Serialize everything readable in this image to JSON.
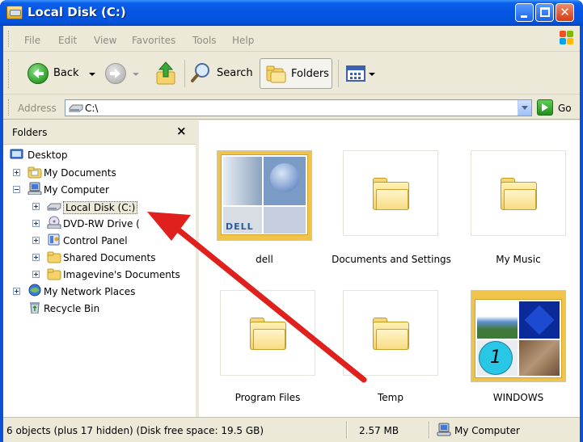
{
  "window": {
    "title": "Local Disk (C:)"
  },
  "menu": {
    "items": [
      "File",
      "Edit",
      "View",
      "Favorites",
      "Tools",
      "Help"
    ]
  },
  "toolbar": {
    "back_label": "Back",
    "search_label": "Search",
    "folders_label": "Folders"
  },
  "address": {
    "label": "Address",
    "value": "C:\\",
    "go_label": "Go"
  },
  "folders_pane": {
    "title": "Folders",
    "close_glyph": "×",
    "tree": [
      {
        "label": "Desktop",
        "icon": "desktop-icon"
      },
      {
        "label": "My Documents",
        "icon": "my-documents-icon"
      },
      {
        "label": "My Computer",
        "icon": "my-computer-icon"
      },
      {
        "label": "Local Disk (C:)",
        "icon": "local-disk-icon",
        "selected": true
      },
      {
        "label": "DVD-RW Drive (",
        "icon": "dvd-drive-icon"
      },
      {
        "label": "Control Panel",
        "icon": "control-panel-icon"
      },
      {
        "label": "Shared Documents",
        "icon": "folder-icon"
      },
      {
        "label": "Imagevine's Documents",
        "icon": "folder-icon"
      },
      {
        "label": "My Network Places",
        "icon": "network-places-icon"
      },
      {
        "label": "Recycle Bin",
        "icon": "recycle-bin-icon"
      }
    ]
  },
  "content": {
    "items": [
      {
        "label": "dell",
        "thumb": "DELL"
      },
      {
        "label": "Documents and Settings"
      },
      {
        "label": "My Music"
      },
      {
        "label": "Program Files"
      },
      {
        "label": "Temp"
      },
      {
        "label": "WINDOWS",
        "thumb": "1"
      }
    ]
  },
  "status": {
    "summary": "6 objects (plus 17 hidden) (Disk free space: 19.5 GB)",
    "size": "2.57 MB",
    "zone": "My Computer"
  },
  "colors": {
    "titlebar": "#0554e3",
    "annotation_arrow": "#e0201c"
  }
}
